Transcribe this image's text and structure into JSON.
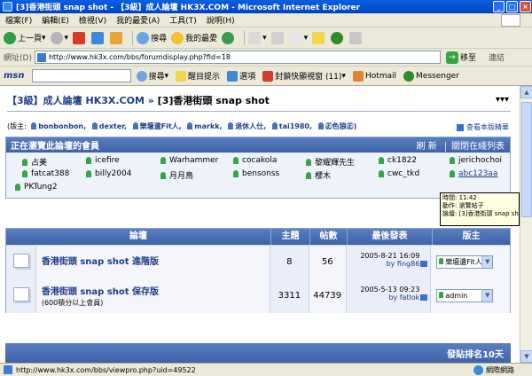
{
  "window": {
    "title": "[3]香港街頭 snap shot - 【3級】成人論壇 HK3X.COM - Microsoft Internet Explorer",
    "minimize": "_",
    "maximize": "□",
    "close": "×"
  },
  "menu": [
    "檔案(F)",
    "編輯(E)",
    "檢視(V)",
    "我的最愛(A)",
    "工具(T)",
    "說明(H)"
  ],
  "toolbar": {
    "back": "上一頁",
    "search": "搜尋",
    "favorites": "我的最愛"
  },
  "address": {
    "label": "網址(D)",
    "url": "http://www.hk3x.com/bbs/forumdisplay.php?fid=18",
    "go": "移至",
    "links": "連結"
  },
  "msnbar": {
    "logo": "msn",
    "search": "搜尋",
    "highlight": "醒目提示",
    "options": "選項",
    "popup": "封鎖快顯視窗 (11)",
    "hotmail": "Hotmail",
    "messenger": "Messenger"
  },
  "page": {
    "crumb_forum": "【3級】成人論壇 HK3X.COM",
    "crumb_sep": " » ",
    "crumb_current": "[3]香港街頭 snap shot",
    "dots": "▾▾▾",
    "moderators_label": "(版主:",
    "moderators": [
      "bonbonbon,",
      "dexter,",
      "樂壇遺Fit人,",
      "markk,",
      "退休人仕,",
      "tai1980,",
      "㊣色狼㊣)"
    ],
    "guide": "查看本版精華",
    "online_title": "正在瀏覽此論壇的會員",
    "online_refresh": "刷 新",
    "online_close": "關閉在綫列表",
    "online_users": [
      {
        "name": "占美"
      },
      {
        "name": "icefire"
      },
      {
        "name": "Warhammer"
      },
      {
        "name": "cocakola"
      },
      {
        "name": "黎耀輝先生"
      },
      {
        "name": "ck1822"
      },
      {
        "name": "jerichochoi"
      },
      {
        "name": "fatcat388"
      },
      {
        "name": "billy2004"
      },
      {
        "name": "月月鳥"
      },
      {
        "name": "bensonss"
      },
      {
        "name": "櫻木"
      },
      {
        "name": "cwc_tkd"
      },
      {
        "name": "abc123aa"
      },
      {
        "name": "PKTung2"
      }
    ],
    "tooltip": {
      "line1": "時間: 11:42",
      "line2": "動作: 瀏覽帖子",
      "line3": "論壇: [3]香港街頭 snap shot"
    },
    "table_headers": {
      "forum": "論壇",
      "topics": "主題",
      "posts": "帖數",
      "last": "最後發表",
      "mod": "版主"
    },
    "forums": [
      {
        "name": "香港街頭 snap shot 進階版",
        "note": "",
        "topics": "8",
        "posts": "56",
        "last_date": "2005-8-21 16:09",
        "last_by": "by fing86",
        "mod": "樂壇遺Fit人"
      },
      {
        "name": "香港街頭 snap shot 保存版",
        "note": "(600積分以上會員)",
        "topics": "3311",
        "posts": "44739",
        "last_date": "2005-5-13 09:23",
        "last_by": "by fatlok",
        "mod": "admin"
      }
    ],
    "bottom_right": "發貼排名10天"
  },
  "status": {
    "url": "http://www.hk3x.com/bbs/viewpro.php?uid=49522",
    "zone": "網際網路"
  }
}
